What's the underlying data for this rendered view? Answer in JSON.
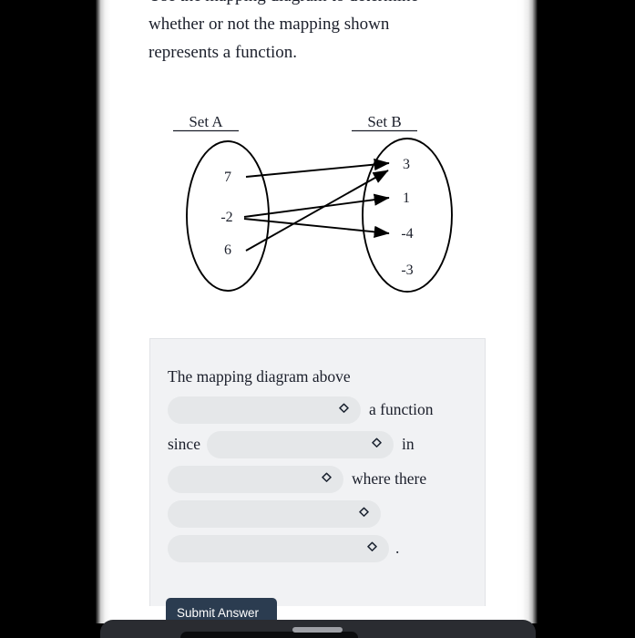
{
  "question": {
    "prompt_lines": [
      "Use the mapping diagram to determine",
      "whether or not the mapping shown",
      "represents a function."
    ]
  },
  "diagram": {
    "set_a_label": "Set A",
    "set_b_label": "Set B",
    "set_a_elements": [
      "7",
      "-2",
      "6"
    ],
    "set_b_elements": [
      "3",
      "1",
      "-4",
      "-3"
    ],
    "mappings": [
      {
        "from": "7",
        "to": "3"
      },
      {
        "from": "-2",
        "to": "1"
      },
      {
        "from": "-2",
        "to": "-4"
      },
      {
        "from": "6",
        "to": "3"
      }
    ]
  },
  "answer_form": {
    "intro_text": "The mapping diagram above",
    "dropdown_1_value": "",
    "text_after_1": "a function",
    "text_before_2": "since",
    "dropdown_2_value": "",
    "text_after_2": "in",
    "dropdown_3_value": "",
    "text_after_3": "where there",
    "dropdown_4_value": "",
    "dropdown_5_value": "",
    "period": ".",
    "chevron_icon": "chevron-up-down-icon"
  },
  "submit": {
    "label": "Submit Answer"
  },
  "colors": {
    "card_bg": "#f1f2f4",
    "select_bg": "#e5e7e9",
    "submit_bg": "#2b3c50",
    "text": "#1b1f2b",
    "chin": "#2a2c31"
  }
}
